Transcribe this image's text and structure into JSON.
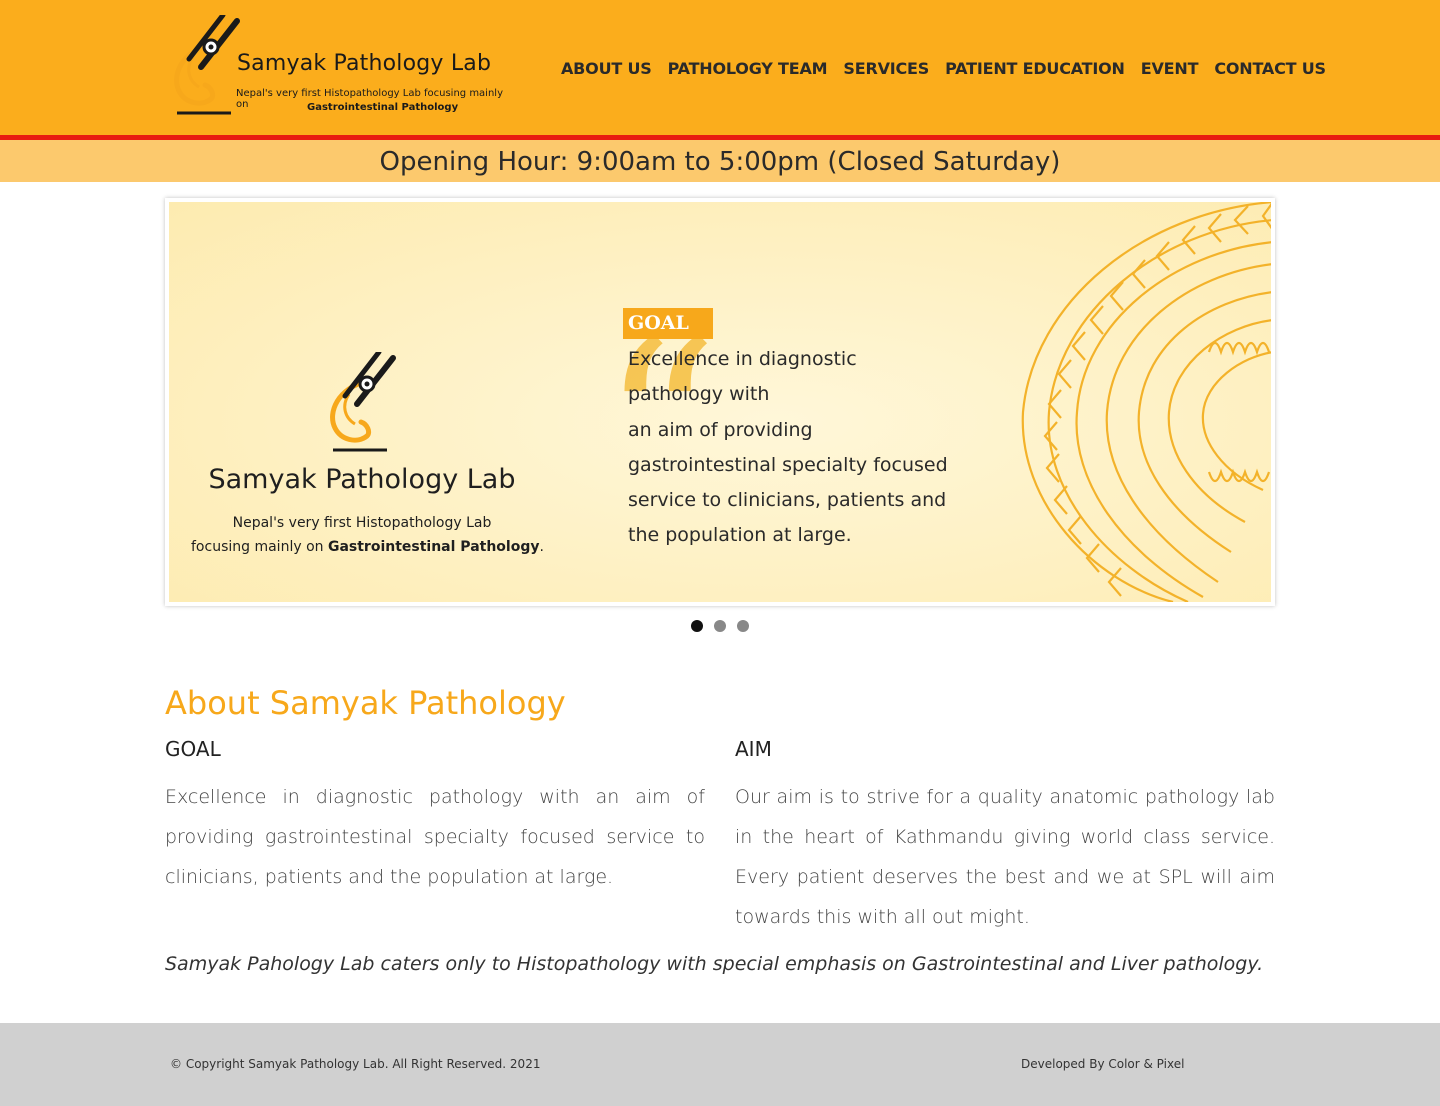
{
  "brand": {
    "name": "Samyak Pathology Lab",
    "tagline_line1": "Nepal's very first Histopathology Lab focusing mainly on",
    "tagline_line2": "Gastrointestinal Pathology"
  },
  "nav": {
    "items": [
      "ABOUT US",
      "PATHOLOGY TEAM",
      "SERVICES",
      "PATIENT EDUCATION",
      "EVENT",
      "CONTACT US"
    ]
  },
  "hours": "Opening Hour: 9:00am to 5:00pm (Closed Saturday)",
  "slider": {
    "brand": "Samyak Pathology Lab",
    "tag_line1": "Nepal's very first Histopathology Lab",
    "tag_prefix": "focusing mainly on ",
    "tag_bold": "Gastrointestinal Pathology",
    "tag_suffix": ".",
    "goal_badge": "GOAL",
    "goal_lines": [
      "Excellence in diagnostic",
      "pathology with",
      "an aim of providing",
      "gastrointestinal specialty focused",
      "service to clinicians, patients and",
      "the population at large."
    ],
    "slide_count": 3,
    "active_slide": 1
  },
  "about": {
    "title": "About Samyak Pathology",
    "goal_heading": "GOAL",
    "goal_text": "Excellence in diagnostic pathology with an aim of providing gastrointestinal specialty focused service to clinicians, patients and the population at large.",
    "aim_heading": "AIM",
    "aim_text": "Our aim is to strive for a quality anatomic pathology lab in the heart of Kathmandu giving world class service. Every patient deserves the best and we at SPL will aim towards this with all out might.",
    "tagline": "Samyak Pahology Lab caters only to Histopathology with special emphasis on Gastrointestinal and Liver pathology."
  },
  "footer": {
    "copyright": "© Copyright Samyak Pathology Lab. All Right Reserved. 2021",
    "developer": "Developed By Color & Pixel"
  },
  "colors": {
    "header_bg": "#fbad1c",
    "header_border": "#e81b10",
    "hours_bg": "#fcc96d",
    "accent": "#f7a81b",
    "footer_bg": "#d0d0d0"
  },
  "icons": [
    "microscope-logo-icon"
  ]
}
